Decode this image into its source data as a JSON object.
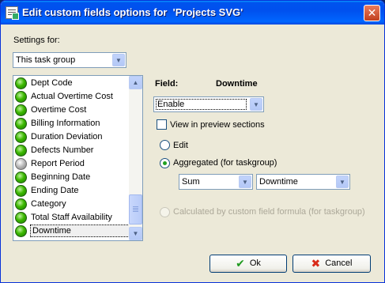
{
  "window": {
    "title": "Edit custom fields options for  'Projects SVG'",
    "close_glyph": "✕"
  },
  "settings": {
    "label": "Settings for:",
    "selected": "This task group"
  },
  "fields_list": {
    "items": [
      {
        "label": "Dept Code",
        "status": "green"
      },
      {
        "label": "Actual Overtime Cost",
        "status": "green"
      },
      {
        "label": "Overtime Cost",
        "status": "green"
      },
      {
        "label": "Billing Information",
        "status": "green"
      },
      {
        "label": "Duration Deviation",
        "status": "green"
      },
      {
        "label": "Defects Number",
        "status": "green"
      },
      {
        "label": "Report Period",
        "status": "gray"
      },
      {
        "label": "Beginning Date",
        "status": "green"
      },
      {
        "label": "Ending Date",
        "status": "green"
      },
      {
        "label": "Category",
        "status": "green"
      },
      {
        "label": "Total Staff Availability",
        "status": "green"
      },
      {
        "label": "Downtime",
        "status": "green",
        "selected": true
      }
    ]
  },
  "field": {
    "label": "Field:",
    "name": "Downtime",
    "mode": "Enable"
  },
  "options": {
    "view_preview": "View in preview sections",
    "view_preview_checked": false,
    "edit": "Edit",
    "aggregated": "Aggregated (for taskgroup)",
    "aggregate_function": "Sum",
    "aggregate_field": "Downtime",
    "calculated": "Calculated by custom field formula (for taskgroup)"
  },
  "buttons": {
    "ok": "Ok",
    "cancel": "Cancel",
    "ok_icon": "✔",
    "cancel_icon": "✖"
  },
  "colors": {
    "title_bar": "#0053ee",
    "dialog_bg": "#ece9d8",
    "ok_check": "#1f9a1f",
    "cancel_x": "#d92b1a"
  }
}
